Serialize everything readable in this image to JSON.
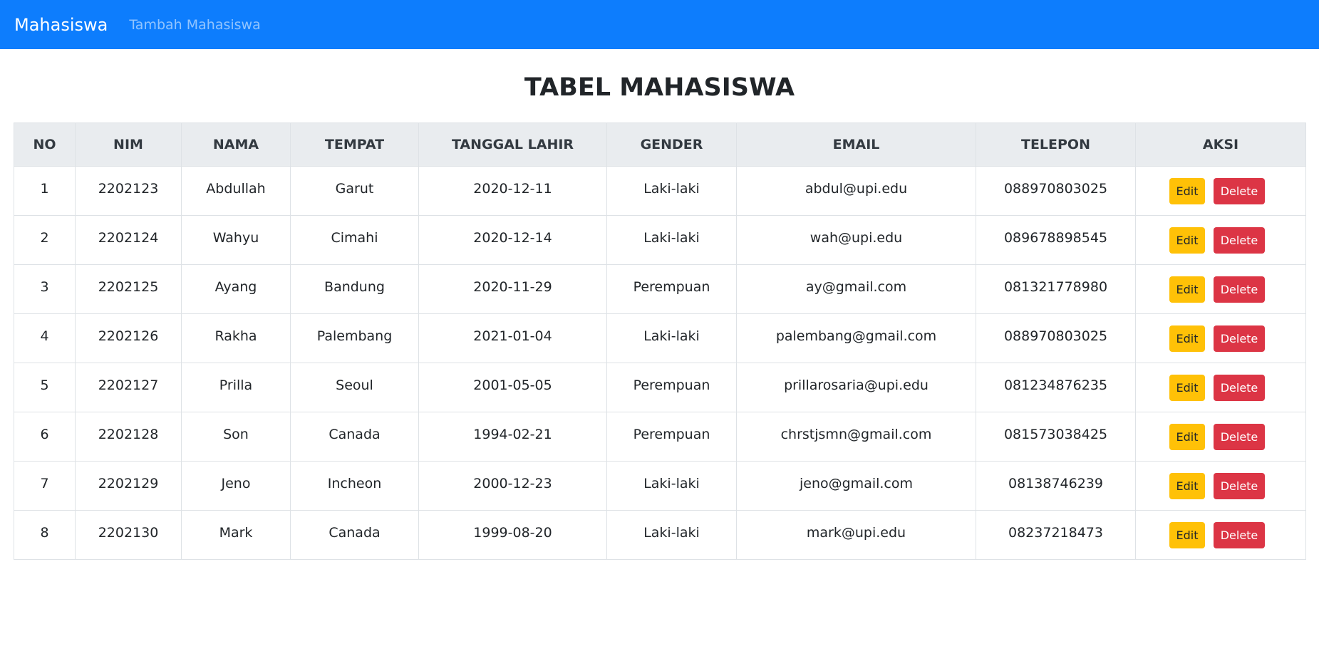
{
  "navbar": {
    "brand": "Mahasiswa",
    "links": [
      "Tambah Mahasiswa"
    ],
    "bg_color": "#0d7dfd"
  },
  "page": {
    "title": "TABEL MAHASISWA"
  },
  "table": {
    "headers": [
      "NO",
      "NIM",
      "NAMA",
      "TEMPAT",
      "TANGGAL LAHIR",
      "GENDER",
      "EMAIL",
      "TELEPON",
      "AKSI"
    ],
    "actions": {
      "edit_label": "Edit",
      "delete_label": "Delete",
      "edit_color": "#ffc107",
      "delete_color": "#dc3545"
    },
    "rows": [
      [
        "1",
        "2202123",
        "Abdullah",
        "Garut",
        "2020-12-11",
        "Laki-laki",
        "abdul@upi.edu",
        "088970803025"
      ],
      [
        "2",
        "2202124",
        "Wahyu",
        "Cimahi",
        "2020-12-14",
        "Laki-laki",
        "wah@upi.edu",
        "089678898545"
      ],
      [
        "3",
        "2202125",
        "Ayang",
        "Bandung",
        "2020-11-29",
        "Perempuan",
        "ay@gmail.com",
        "081321778980"
      ],
      [
        "4",
        "2202126",
        "Rakha",
        "Palembang",
        "2021-01-04",
        "Laki-laki",
        "palembang@gmail.com",
        "088970803025"
      ],
      [
        "5",
        "2202127",
        "Prilla",
        "Seoul",
        "2001-05-05",
        "Perempuan",
        "prillarosaria@upi.edu",
        "081234876235"
      ],
      [
        "6",
        "2202128",
        "Son",
        "Canada",
        "1994-02-21",
        "Perempuan",
        "chrstjsmn@gmail.com",
        "081573038425"
      ],
      [
        "7",
        "2202129",
        "Jeno",
        "Incheon",
        "2000-12-23",
        "Laki-laki",
        "jeno@gmail.com",
        "08138746239"
      ],
      [
        "8",
        "2202130",
        "Mark",
        "Canada",
        "1999-08-20",
        "Laki-laki",
        "mark@upi.edu",
        "08237218473"
      ]
    ]
  }
}
